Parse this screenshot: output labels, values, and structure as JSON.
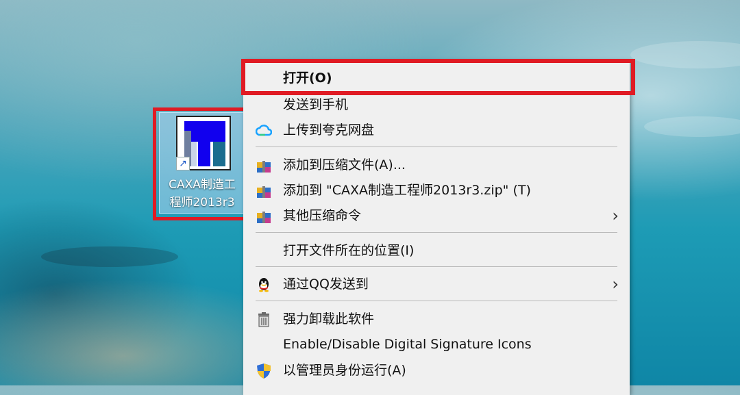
{
  "desktop_icon": {
    "label_line1": "CAXA制造工",
    "label_line2": "程师2013r3",
    "icon": "caxa-app-icon",
    "shortcut_icon": "shortcut-arrow-icon"
  },
  "context_menu": {
    "items": [
      {
        "label": "打开(O)",
        "icon": null
      },
      {
        "label": "发送到手机",
        "icon": null
      },
      {
        "label": "上传到夸克网盘",
        "icon": "cloud-icon"
      },
      {
        "label": "添加到压缩文件(A)...",
        "icon": "archive-icon"
      },
      {
        "label": "添加到 \"CAXA制造工程师2013r3.zip\" (T)",
        "icon": "archive-icon"
      },
      {
        "label": "其他压缩命令",
        "icon": "archive-icon",
        "submenu": true
      },
      {
        "label": "打开文件所在的位置(I)",
        "icon": null
      },
      {
        "label": "通过QQ发送到",
        "icon": "qq-penguin-icon",
        "submenu": true
      },
      {
        "label": "强力卸载此软件",
        "icon": "trash-icon"
      },
      {
        "label": "Enable/Disable Digital Signature Icons",
        "icon": null
      },
      {
        "label": "以管理员身份运行(A)",
        "icon": "uac-shield-icon"
      }
    ],
    "submenu_glyph": "›"
  },
  "colors": {
    "highlight": "#e01b24",
    "menu_bg": "#f0f0f0"
  }
}
